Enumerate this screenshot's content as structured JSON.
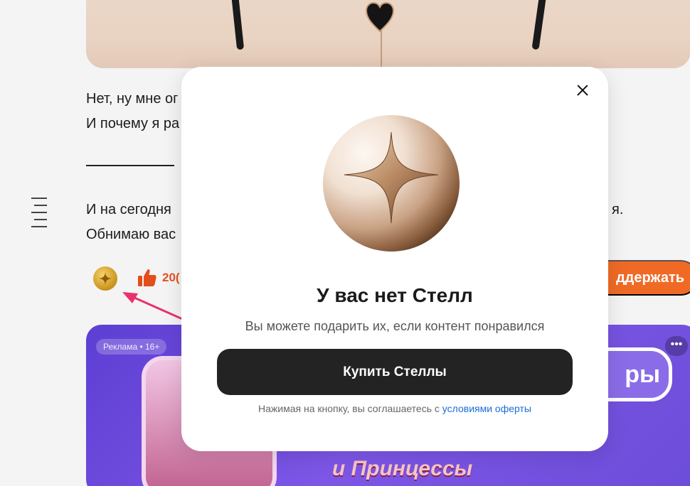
{
  "article": {
    "line1": "Нет, ну мне ог",
    "line2": "И почему я ра",
    "divider": "________",
    "line3_left": "И на сегодня",
    "line3_right": "я.",
    "line4": "Обнимаю вас",
    "like_count": "20(",
    "support_label": "ддержать"
  },
  "ad": {
    "badge": "Реклама • 16+",
    "menu": "•••",
    "frame_text": "ры",
    "title": "и Принцессы"
  },
  "modal": {
    "title": "У вас нет Стелл",
    "subtitle": "Вы можете подарить их, если контент понравился",
    "buy_label": "Купить Стеллы",
    "terms_prefix": "Нажимая на кнопку, вы соглашаетесь с ",
    "terms_link": "условиями оферты"
  },
  "colors": {
    "accent": "#f06a26",
    "like": "#e24f1b",
    "link": "#1a6fd3",
    "button_dark": "#232323",
    "annotation_arrow": "#e8326a"
  },
  "icons": {
    "close": "close-icon",
    "coin": "stella-coin-icon",
    "like": "thumbs-up-icon",
    "toc": "table-of-contents-icon"
  }
}
